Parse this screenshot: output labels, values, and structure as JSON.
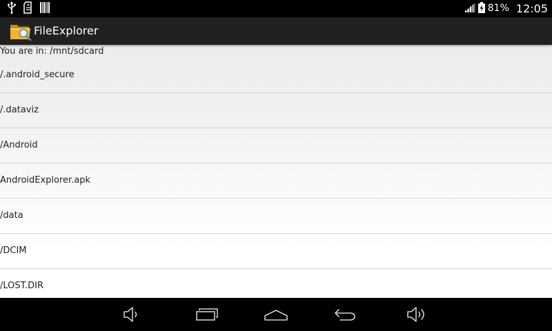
{
  "status_bar": {
    "battery_percent": "81%",
    "time": "12:05",
    "icons": [
      "usb-icon",
      "sd-card-icon",
      "barcode-icon",
      "signal-icon",
      "battery-icon"
    ]
  },
  "action_bar": {
    "title": "FileExplorer",
    "icon": "folder-search-icon"
  },
  "path": {
    "text": "You are in: /mnt/sdcard"
  },
  "files": [
    {
      "name": "/.android_secure"
    },
    {
      "name": "/.dataviz"
    },
    {
      "name": "/Android"
    },
    {
      "name": "AndroidExplorer.apk"
    },
    {
      "name": "/data"
    },
    {
      "name": "/DCIM"
    },
    {
      "name": "/LOST.DIR"
    }
  ],
  "nav_bar": {
    "buttons": [
      "volume-down-icon",
      "recent-apps-icon",
      "home-icon",
      "back-icon",
      "volume-up-icon"
    ]
  },
  "colors": {
    "status_bar_bg": "#000000",
    "action_bar_bg": "#212121",
    "text": "#222222",
    "divider": "#d6d6d6",
    "folder_icon": "#f0b020"
  }
}
